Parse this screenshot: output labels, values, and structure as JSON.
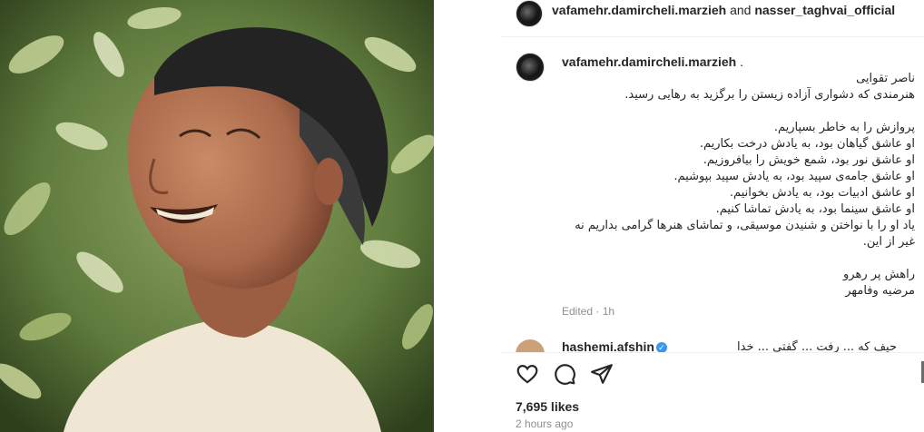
{
  "header": {
    "user1": "vafamehr.damircheli.marzieh",
    "conjunction": "and",
    "user2": "nasser_taghvai_official"
  },
  "caption": {
    "username": "vafamehr.damircheli.marzieh",
    "suffix": ".",
    "text": "ناصر تقوایی\nهنرمندی که دشواری آزاده زیستن را برگزید به رهایی رسید.\n\nپروازش را به خاطر بسپاریم.\nاو عاشق گیاهان بود، به یادش درخت بکاریم.\nاو عاشق نور بود، شمع خویش را بیافروزیم.\nاو عاشق جامه‌ی سپید بود، به یادش سپید بپوشیم.\nاو عاشق ادبیات بود، به یادش بخوانیم.\nاو عاشق سینما بود، به یادش تماشا کنیم.\nیاد او را با نواختن و شنیدن موسیقی، و تماشای هنرها گرامی بداریم نه\nغیر از این.\n\nراهش پر رهرو\nمرضیه وفامهر",
    "edited": "Edited",
    "separator": "·",
    "time": "1h"
  },
  "comment": {
    "username": "hashemi.afshin",
    "verified_icon": "verified-badge-icon",
    "text": "حیف که ... رفت ... گفتی ... خدا"
  },
  "actions": {
    "like_icon": "heart-icon",
    "comment_icon": "comment-icon",
    "share_icon": "share-icon"
  },
  "likes": "7,695 likes",
  "posted": "2 hours ago"
}
